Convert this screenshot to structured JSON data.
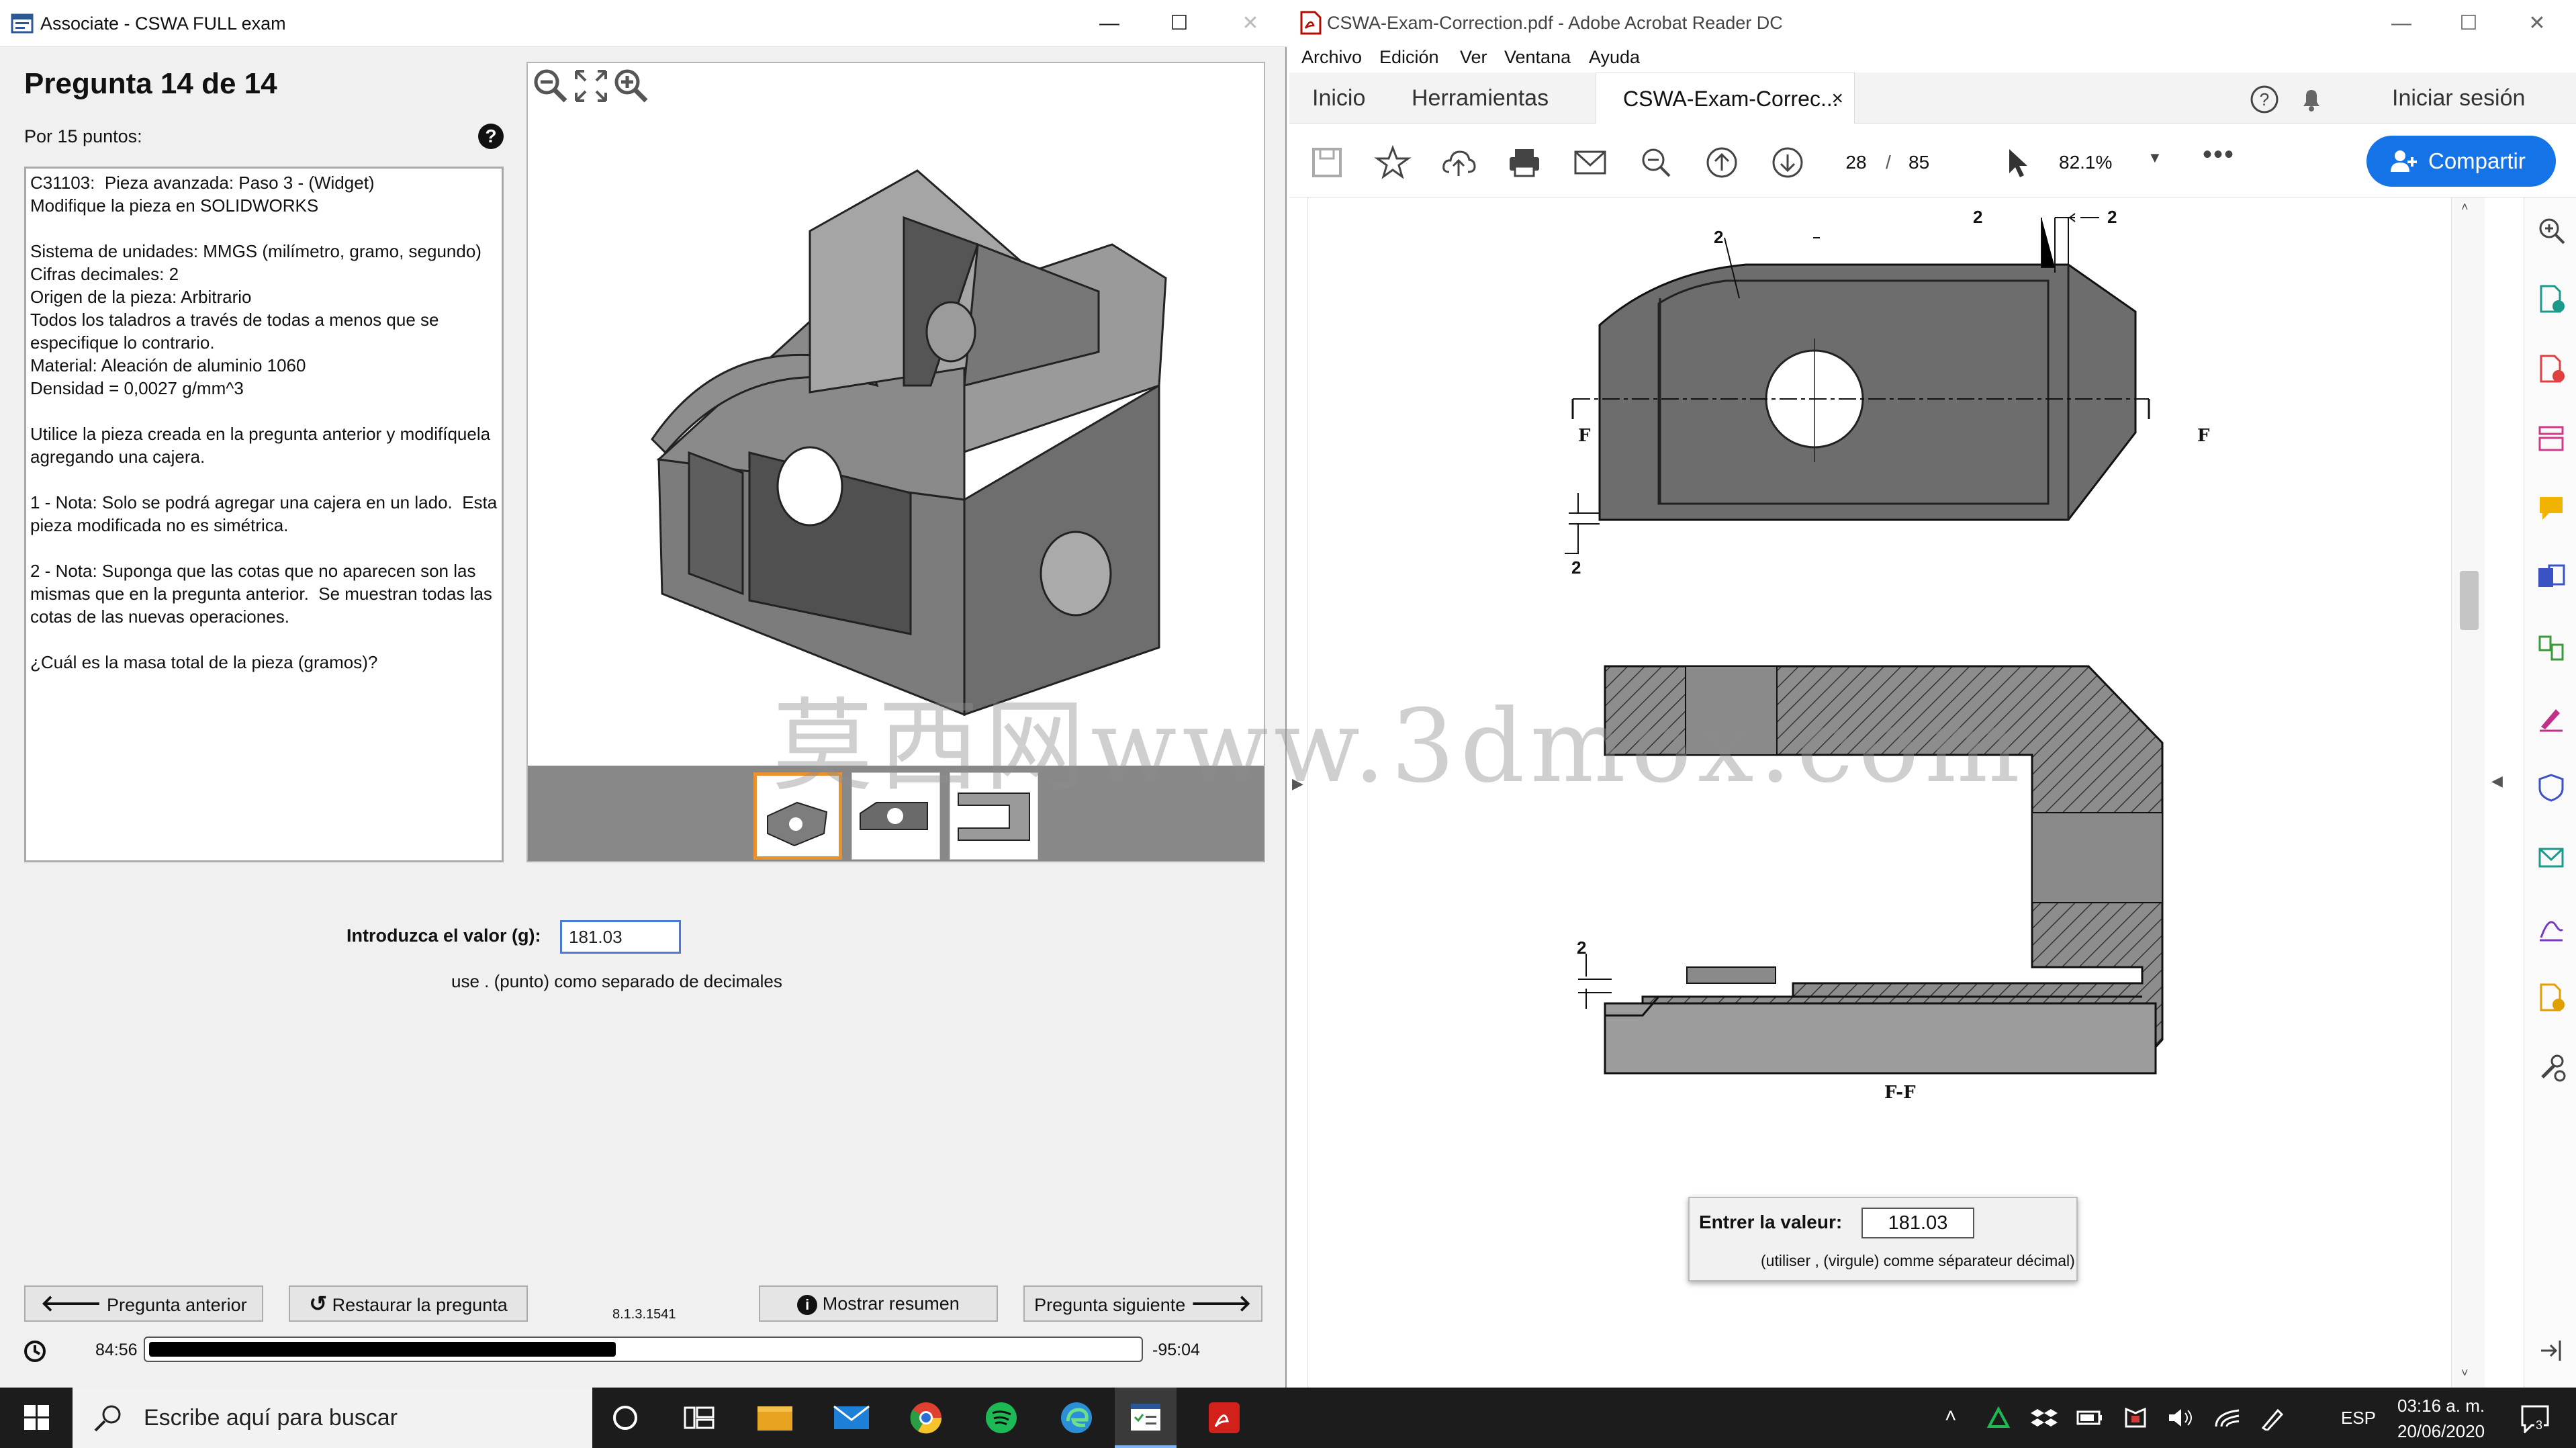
{
  "exam": {
    "window_title": "Associate - CSWA FULL exam",
    "question_title": "Pregunta 14 de 14",
    "points": "Por 15 puntos:",
    "help": "?",
    "question_lines": [
      "C31103:  Pieza avanzada: Paso 3 - (Widget)",
      "Modifique la pieza en SOLIDWORKS",
      "",
      "Sistema de unidades: MMGS (milímetro, gramo, segundo)",
      "Cifras decimales: 2",
      "Origen de la pieza: Arbitrario",
      "Todos los taladros a través de todas a menos que se",
      "especifique lo contrario.",
      "Material: Aleación de aluminio 1060",
      "Densidad = 0,0027 g/mm^3",
      "",
      "Utilice la pieza creada en la pregunta anterior y modifíquela",
      "agregando una cajera.",
      "",
      "1 - Nota: Solo se podrá agregar una cajera en un lado.  Esta",
      "pieza modificada no es simétrica.",
      "",
      "2 - Nota: Suponga que las cotas que no aparecen son las",
      "mismas que en la pregunta anterior.  Se muestran todas las",
      "cotas de las nuevas operaciones.",
      "",
      "¿Cuál es la masa total de la pieza (gramos)?"
    ],
    "value_label": "Introduzca el valor (g):",
    "value": "181.03",
    "decimal_hint": "use . (punto) como separado de decimales",
    "prev_button": "Pregunta anterior",
    "restore_button": "Restaurar la pregunta",
    "version": "8.1.3.1541",
    "summary_button": "Mostrar resumen",
    "next_button": "Pregunta siguiente",
    "elapsed": "84:56",
    "remaining": "-95:04",
    "progress_fraction": 0.472
  },
  "acrobat": {
    "window_title": "CSWA-Exam-Correction.pdf - Adobe Acrobat Reader DC",
    "menu": [
      "Archivo",
      "Edición",
      "Ver",
      "Ventana",
      "Ayuda"
    ],
    "tab_home": "Inicio",
    "tab_tools": "Herramientas",
    "tab_doc": "CSWA-Exam-Correc...",
    "tab_close": "×",
    "sign_in": "Iniciar sesión",
    "page_current": "28",
    "page_sep": "/",
    "page_total": "85",
    "zoom": "82.1%",
    "share": "Compartir",
    "dims": {
      "d1": "2",
      "d2": "2",
      "d3": "2",
      "d4": "2",
      "d5": "2"
    },
    "cut_left": "F",
    "cut_right": "F",
    "section_label": "F-F",
    "dialog_label": "Entrer la valeur:",
    "dialog_value": "181.03",
    "dialog_hint": "(utiliser , (virgule) comme séparateur décimal)"
  },
  "watermark": "莫西网www.3dmox.com",
  "taskbar": {
    "search_placeholder": "Escribe aquí para buscar",
    "language": "ESP",
    "time": "03:16 a. m.",
    "date": "20/06/2020",
    "notifications": "3"
  },
  "colors": {
    "accent": "#1473e6",
    "selected_thumb": "#e8912d",
    "taskbar": "#1c1c1c"
  }
}
